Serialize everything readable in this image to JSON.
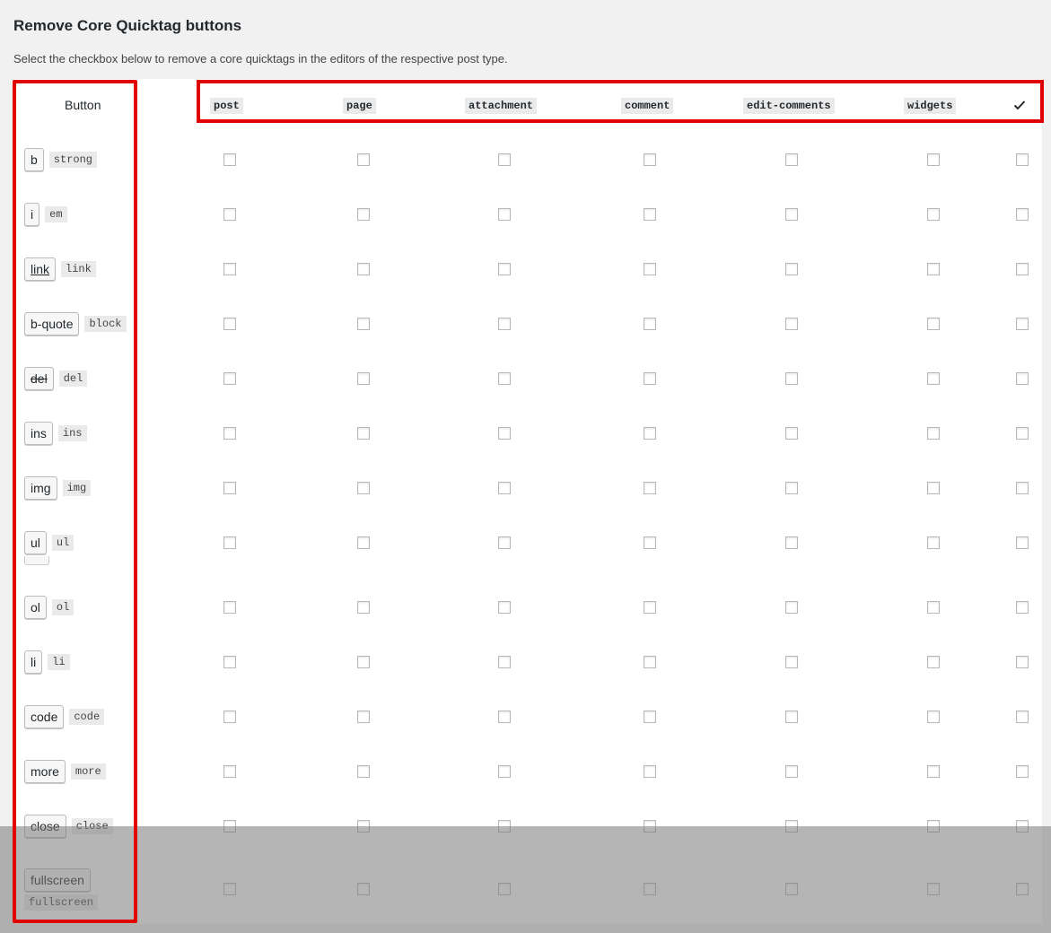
{
  "page": {
    "title": "Remove Core Quicktag buttons",
    "description": "Select the checkbox below to remove a core quicktags in the editors of the respective post type."
  },
  "table": {
    "button_column_header": "Button",
    "columns": [
      "post",
      "page",
      "attachment",
      "comment",
      "edit-comments",
      "widgets"
    ],
    "select_all_icon": "checkmark-icon",
    "rows": [
      {
        "label": "b",
        "tag": "strong"
      },
      {
        "label": "i",
        "tag": "em"
      },
      {
        "label": "link",
        "tag": "link"
      },
      {
        "label": "b-quote",
        "tag": "block"
      },
      {
        "label": "del",
        "tag": "del"
      },
      {
        "label": "ins",
        "tag": "ins"
      },
      {
        "label": "img",
        "tag": "img"
      },
      {
        "label": "ul",
        "tag": "ul"
      },
      {
        "label": "ol",
        "tag": "ol"
      },
      {
        "label": "li",
        "tag": "li"
      },
      {
        "label": "code",
        "tag": "code"
      },
      {
        "label": "more",
        "tag": "more"
      },
      {
        "label": "close",
        "tag": "close"
      },
      {
        "label": "fullscreen",
        "tag": "fullscreen"
      }
    ]
  },
  "colors": {
    "highlight_border": "#e00000",
    "background": "#f1f1f1"
  }
}
